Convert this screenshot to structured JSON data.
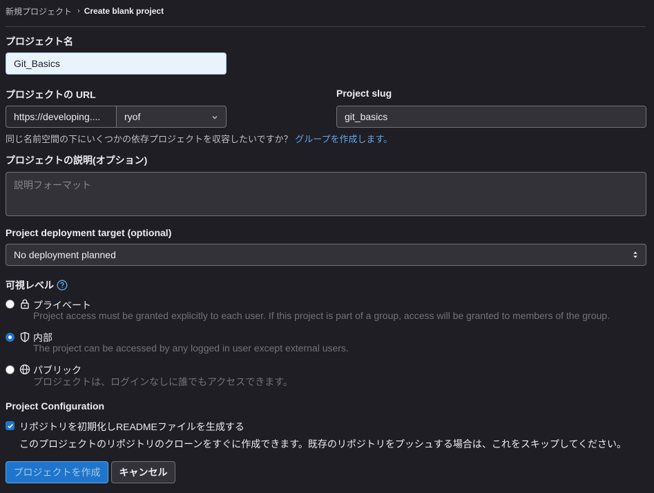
{
  "breadcrumb": {
    "parent": "新規プロジェクト",
    "separator": "›",
    "current": "Create blank project"
  },
  "project_name": {
    "label": "プロジェクト名",
    "value": "Git_Basics"
  },
  "project_url": {
    "label": "プロジェクトの URL",
    "prefix": "https://developing....",
    "namespace": "ryof"
  },
  "project_slug": {
    "label": "Project slug",
    "value": "git_basics"
  },
  "group_help": {
    "text": "同じ名前空間の下にいくつかの依存プロジェクトを収容したいですか？",
    "link": "グループを作成します。"
  },
  "description": {
    "label": "プロジェクトの説明(オプション)",
    "placeholder": "説明フォーマット"
  },
  "deployment": {
    "label": "Project deployment target (optional)",
    "selected": "No deployment planned"
  },
  "visibility": {
    "label": "可視レベル",
    "options": [
      {
        "title": "プライベート",
        "description": "Project access must be granted explicitly to each user. If this project is part of a group, access will be granted to members of the group.",
        "icon": "lock-icon",
        "checked": false
      },
      {
        "title": "内部",
        "description": "The project can be accessed by any logged in user except external users.",
        "icon": "shield-icon",
        "checked": true
      },
      {
        "title": "パブリック",
        "description": "プロジェクトは、ログインなしに誰でもアクセスできます。",
        "icon": "globe-icon",
        "checked": false
      }
    ]
  },
  "configuration": {
    "label": "Project Configuration",
    "readme_label": "リポジトリを初期化しREADMEファイルを生成する",
    "readme_checked": true,
    "readme_help": "このプロジェクトのリポジトリのクローンをすぐに作成できます。既存のリポジトリをプッシュする場合は、これをスキップしてください。"
  },
  "buttons": {
    "create": "プロジェクトを作成",
    "cancel": "キャンセル"
  },
  "colors": {
    "background": "#1f1e24",
    "accent": "#1f75cb",
    "link": "#63a6e9"
  }
}
